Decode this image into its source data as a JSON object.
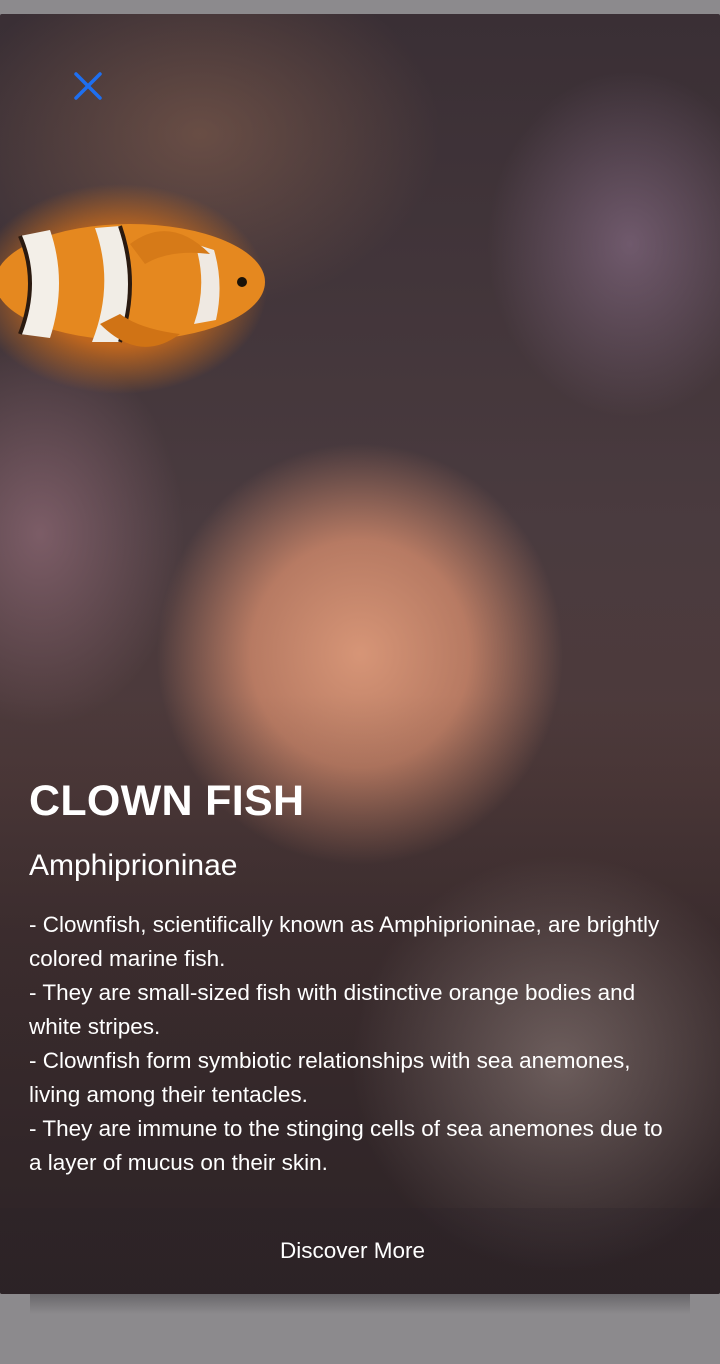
{
  "modal": {
    "close_icon": "close-icon",
    "title": "CLOWN FISH",
    "subtitle": "Amphiprioninae",
    "description": [
      "- Clownfish, scientifically known as Amphiprioninae, are brightly colored marine fish.",
      "- They are small-sized fish with distinctive orange bodies and white stripes.",
      "- Clownfish form symbiotic relationships with sea anemones, living among their tentacles.",
      "- They are immune to the stinging cells of sea anemones due to a layer of mucus on their skin."
    ],
    "discover_label": "Discover More"
  },
  "colors": {
    "accent": "#1e6ff0",
    "text": "#ffffff",
    "backdrop": "#8c8a8d"
  }
}
